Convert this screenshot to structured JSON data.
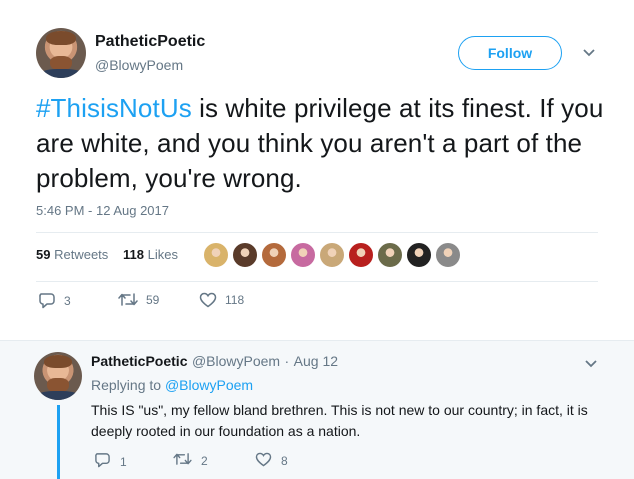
{
  "tweet": {
    "display_name": "PatheticPoetic",
    "handle": "@BlowyPoem",
    "follow_label": "Follow",
    "hashtag": "#ThisisNotUs",
    "text_after_hashtag": " is white privilege at its finest. If you are white, and you think you aren't a part of the problem, you're wrong.",
    "timestamp": "5:46 PM - 12 Aug 2017",
    "retweets_count": "59",
    "retweets_label": "Retweets",
    "likes_count": "118",
    "likes_label": "Likes",
    "actions": {
      "reply_count": "3",
      "retweet_count": "59",
      "like_count": "118"
    },
    "likers": [
      {
        "color": "#d9b36a"
      },
      {
        "color": "#5a3b2a"
      },
      {
        "color": "#b46a3c"
      },
      {
        "color": "#c76aa0"
      },
      {
        "color": "#c9a878"
      },
      {
        "color": "#b8201e"
      },
      {
        "color": "#6b6b4a"
      },
      {
        "color": "#222222"
      },
      {
        "color": "#8a8a8a"
      }
    ]
  },
  "reply": {
    "display_name": "PatheticPoetic",
    "handle": "@BlowyPoem",
    "separator": "·",
    "date": "Aug 12",
    "replying_prefix": "Replying to",
    "replying_handle": "@BlowyPoem",
    "text": "This IS \"us\", my fellow bland brethren. This is not new to our country; in fact, it is deeply rooted in our foundation as a nation.",
    "actions": {
      "reply_count": "1",
      "retweet_count": "2",
      "like_count": "8"
    }
  },
  "colors": {
    "accent": "#1da1f2",
    "muted": "#657786",
    "text": "#14171a"
  }
}
